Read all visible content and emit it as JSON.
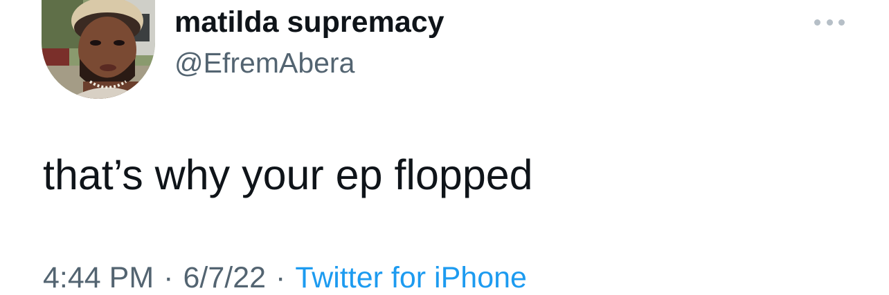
{
  "author": {
    "display_name": "matilda supremacy",
    "handle": "@EfremAbera"
  },
  "tweet": {
    "text": "that’s why your ep flopped"
  },
  "meta": {
    "time": "4:44 PM",
    "separator": "·",
    "date": "6/7/22",
    "source": "Twitter for iPhone"
  },
  "icons": {
    "more": "more-horizontal-icon"
  },
  "colors": {
    "text_primary": "#0f1419",
    "text_secondary": "#536471",
    "link": "#1d9bf0",
    "more_dots": "#b6bfc7"
  }
}
